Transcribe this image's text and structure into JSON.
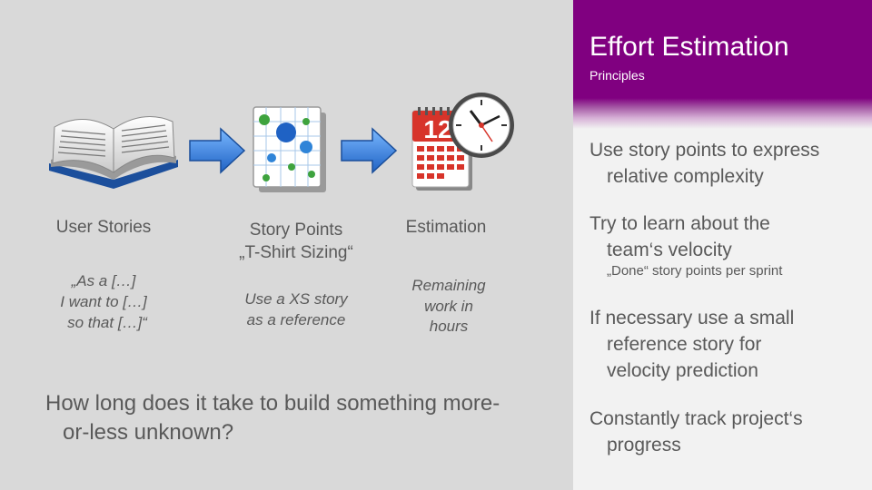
{
  "slide": {
    "title": "Effort Estimation",
    "subtitle": "Principles",
    "bullets": [
      {
        "line1": "Use story points to express",
        "line2": "relative complexity"
      },
      {
        "line1": "Try to learn about the",
        "line2": "team‘s velocity",
        "sub": "„Done“ story points per sprint"
      },
      {
        "line1": "If necessary use a small",
        "line2": "reference story for",
        "line3": "velocity prediction"
      },
      {
        "line1": "Constantly track project‘s",
        "line2": "progress"
      }
    ],
    "steps": [
      {
        "icon": "open-book-icon",
        "label1": "User Stories",
        "quote": [
          "„As a […]",
          "I want to […]",
          "so that […]“"
        ]
      },
      {
        "icon": "chart-grid-icon",
        "label1": "Story Points",
        "label2": "„T-Shirt Sizing“",
        "quote": [
          "Use a XS story",
          "as a reference"
        ]
      },
      {
        "icon": "calendar-clock-icon",
        "label1": "Estimation",
        "quote": [
          "Remaining",
          "work in",
          "hours"
        ],
        "calendar_day": "12"
      }
    ],
    "question": {
      "line1": "How long does it take to build something more-",
      "line2": "or-less unknown?"
    },
    "colors": {
      "accent": "#800080",
      "arrow": "#3a86e0",
      "text": "#595959"
    }
  }
}
